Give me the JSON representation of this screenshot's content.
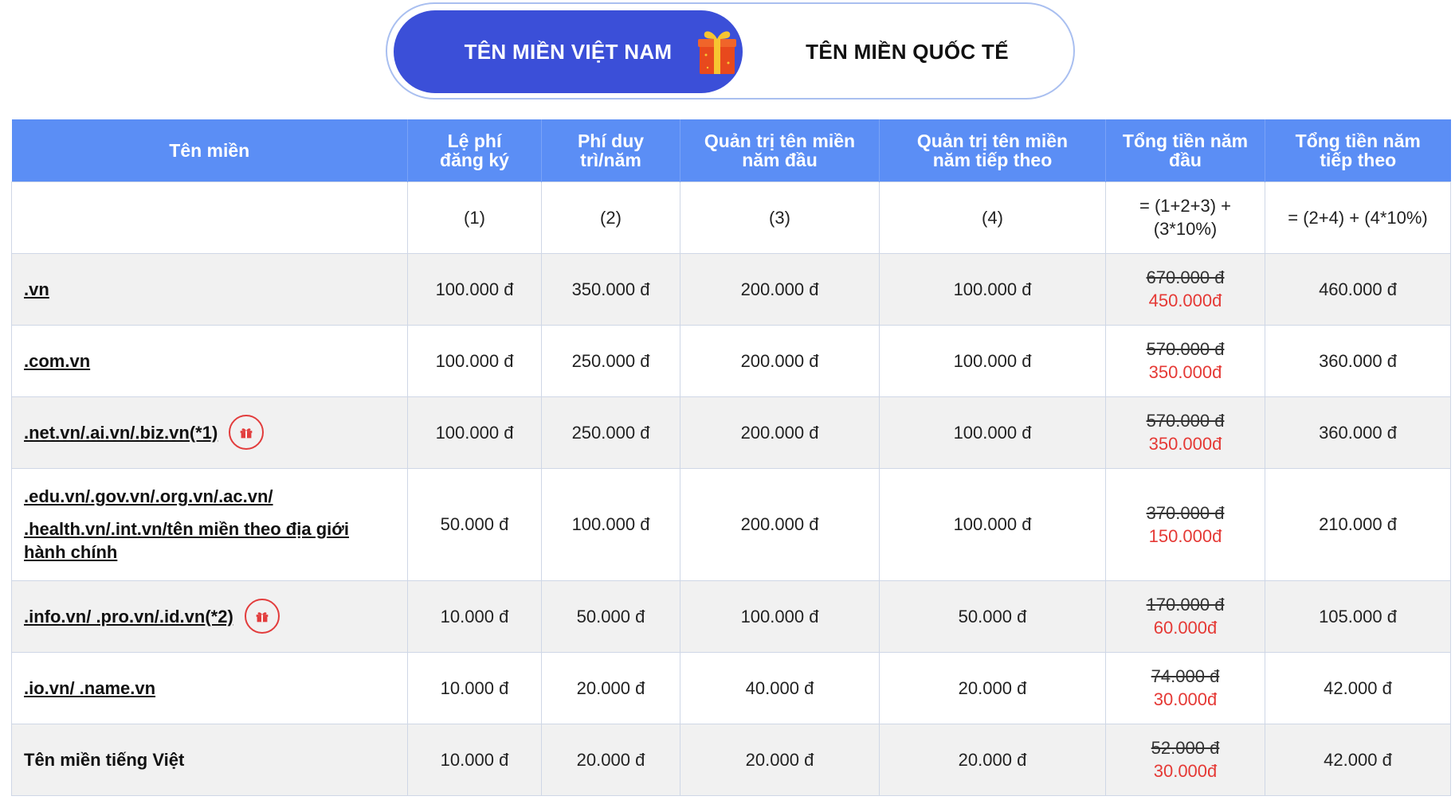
{
  "tabs": {
    "vietnam": "TÊN MIỀN VIỆT NAM",
    "international": "TÊN MIỀN QUỐC TẾ"
  },
  "colors": {
    "tab_active": "#3b4fd8",
    "header_bg": "#5b8ef5",
    "promo_price": "#e53935",
    "gift_icon": "#e23c3c"
  },
  "table": {
    "headers": {
      "domain": "Tên miền",
      "reg_fee": [
        "Lệ phí",
        "đăng ký"
      ],
      "maint_fee": [
        "Phí duy",
        "trì/năm"
      ],
      "admin_first": [
        "Quản trị tên miền",
        "năm đầu"
      ],
      "admin_next": [
        "Quản trị tên miền",
        "năm tiếp theo"
      ],
      "total_first": [
        "Tổng tiền năm",
        "đầu"
      ],
      "total_next": [
        "Tổng tiền năm",
        "tiếp theo"
      ]
    },
    "formula": {
      "c1": "(1)",
      "c2": "(2)",
      "c3": "(3)",
      "c4": "(4)",
      "c5": [
        "= (1+2+3) +",
        "(3*10%)"
      ],
      "c6": "= (2+4) + (4*10%)"
    },
    "rows": [
      {
        "name": ".vn",
        "reg": "100.000 đ",
        "maint": "350.000 đ",
        "admin_first": "200.000 đ",
        "admin_next": "100.000 đ",
        "old_total": "670.000 đ",
        "new_total": "450.000đ",
        "next_total": "460.000 đ"
      },
      {
        "name": ".com.vn",
        "reg": "100.000 đ",
        "maint": "250.000 đ",
        "admin_first": "200.000 đ",
        "admin_next": "100.000 đ",
        "old_total": "570.000 đ",
        "new_total": "350.000đ",
        "next_total": "360.000 đ"
      },
      {
        "name": ".net.vn/.ai.vn/.biz.vn(*1)",
        "reg": "100.000 đ",
        "maint": "250.000 đ",
        "admin_first": "200.000 đ",
        "admin_next": "100.000 đ",
        "old_total": "570.000 đ",
        "new_total": "350.000đ",
        "next_total": "360.000 đ"
      },
      {
        "name_lines": [
          ".edu.vn/.gov.vn/.org.vn/.ac.vn/",
          ".health.vn/.int.vn/tên miền theo địa giới",
          "hành chính"
        ],
        "reg": "50.000 đ",
        "maint": "100.000 đ",
        "admin_first": "200.000 đ",
        "admin_next": "100.000 đ",
        "old_total": "370.000 đ",
        "new_total": "150.000đ",
        "next_total": "210.000 đ"
      },
      {
        "name": ".info.vn/ .pro.vn/.id.vn(*2)",
        "reg": "10.000 đ",
        "maint": "50.000 đ",
        "admin_first": "100.000 đ",
        "admin_next": "50.000 đ",
        "old_total": "170.000 đ",
        "new_total": "60.000đ",
        "next_total": "105.000 đ"
      },
      {
        "name": ".io.vn/ .name.vn",
        "reg": "10.000 đ",
        "maint": "20.000 đ",
        "admin_first": "40.000 đ",
        "admin_next": "20.000 đ",
        "old_total": "74.000 đ",
        "new_total": "30.000đ",
        "next_total": "42.000 đ"
      },
      {
        "name": "Tên miền tiếng Việt",
        "reg": "10.000 đ",
        "maint": "20.000 đ",
        "admin_first": "20.000 đ",
        "admin_next": "20.000 đ",
        "old_total": "52.000 đ",
        "new_total": "30.000đ",
        "next_total": "42.000 đ"
      }
    ]
  }
}
